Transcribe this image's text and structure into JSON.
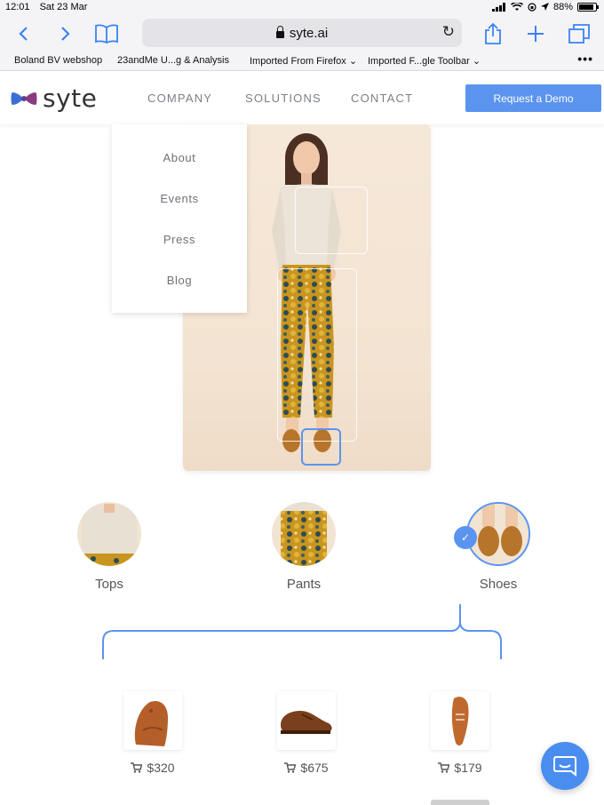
{
  "status_bar": {
    "time": "12:01",
    "date": "Sat 23 Mar",
    "battery": "88%",
    "battery_level": 0.88
  },
  "toolbar": {
    "url": "syte.ai",
    "icons": [
      "back-icon",
      "forward-icon",
      "bookmarks-icon",
      "share-icon",
      "new-tab-icon",
      "tabs-icon",
      "reload-icon",
      "lock-icon"
    ]
  },
  "bookmarks": [
    "Boland BV webshop",
    "23andMe U...g & Analysis",
    "Imported From Firefox",
    "Imported F...gle Toolbar"
  ],
  "site": {
    "logo": "syte",
    "nav": [
      "COMPANY",
      "SOLUTIONS",
      "CONTACT"
    ],
    "cta": "Request a Demo",
    "company_menu": [
      "About",
      "Events",
      "Press",
      "Blog"
    ]
  },
  "categories": [
    {
      "label": "Tops",
      "selected": false
    },
    {
      "label": "Pants",
      "selected": false
    },
    {
      "label": "Shoes",
      "selected": true
    }
  ],
  "products": [
    {
      "price": "$320"
    },
    {
      "price": "$675"
    },
    {
      "price": "$179"
    }
  ],
  "colors": {
    "accent": "#5b94ef",
    "chat": "#4a8df0",
    "brand_purple": "#8b3a7e",
    "brand_blue": "#3b6fd4"
  }
}
